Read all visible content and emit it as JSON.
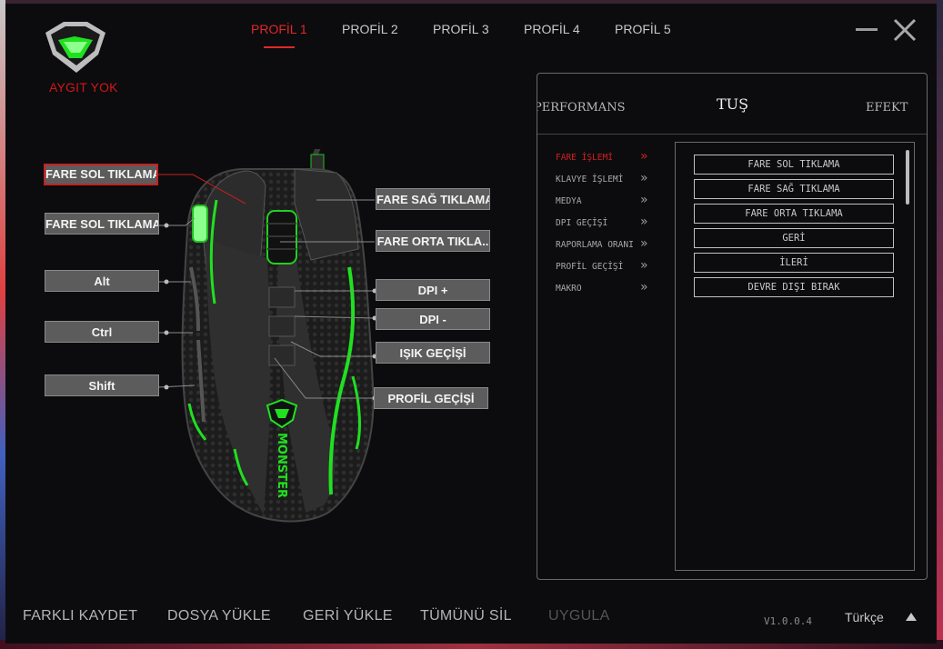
{
  "app": {
    "status": "AYGIT YOK",
    "accent_color": "#e02828",
    "brand_green": "#20e020"
  },
  "profiles": {
    "tabs": [
      {
        "label": "PROFİL 1",
        "active": true
      },
      {
        "label": "PROFİL 2",
        "active": false
      },
      {
        "label": "PROFİL 3",
        "active": false
      },
      {
        "label": "PROFİL 4",
        "active": false
      },
      {
        "label": "PROFİL 5",
        "active": false
      }
    ]
  },
  "window": {
    "minimize_icon": "minimize-icon",
    "close_icon": "close-icon"
  },
  "mouse": {
    "brand_text": "MONSTER",
    "buttons": [
      {
        "label": "FARE SOL TIKLAMA",
        "selected": true
      },
      {
        "label": "FARE SOL TIKLAMA",
        "selected": false
      },
      {
        "label": "Alt",
        "selected": false
      },
      {
        "label": "Ctrl",
        "selected": false
      },
      {
        "label": "Shift",
        "selected": false
      },
      {
        "label": "FARE SAĞ TIKLAMA",
        "selected": false
      },
      {
        "label": "FARE ORTA TIKLA..",
        "selected": false
      },
      {
        "label": "DPI +",
        "selected": false
      },
      {
        "label": "DPI -",
        "selected": false
      },
      {
        "label": "IŞIK GEÇİŞİ",
        "selected": false
      },
      {
        "label": "PROFİL GEÇİŞİ",
        "selected": false
      }
    ]
  },
  "panel": {
    "tabs": [
      {
        "label": "PERFORMANS",
        "active": false
      },
      {
        "label": "TUŞ",
        "active": true
      },
      {
        "label": "EFEKT",
        "active": false
      }
    ],
    "categories": [
      {
        "label": "FARE İŞLEMİ",
        "active": true
      },
      {
        "label": "KLAVYE İŞLEMİ",
        "active": false
      },
      {
        "label": "MEDYA",
        "active": false
      },
      {
        "label": "DPI GEÇİŞİ",
        "active": false
      },
      {
        "label": "RAPORLAMA ORANI",
        "active": false
      },
      {
        "label": "PROFİL GEÇİŞİ",
        "active": false
      },
      {
        "label": "MAKRO",
        "active": false
      }
    ],
    "chevron": "»",
    "options": [
      "FARE SOL TIKLAMA",
      "FARE SAĞ TIKLAMA",
      "FARE ORTA TIKLAMA",
      "GERİ",
      "İLERİ",
      "DEVRE DIŞI BIRAK"
    ]
  },
  "footer": {
    "save_as": "FARKLI KAYDET",
    "load_file": "DOSYA YÜKLE",
    "restore": "GERİ YÜKLE",
    "delete_all": "TÜMÜNÜ SİL",
    "apply": "UYGULA",
    "version": "V1.0.0.4",
    "language": "Türkçe"
  }
}
